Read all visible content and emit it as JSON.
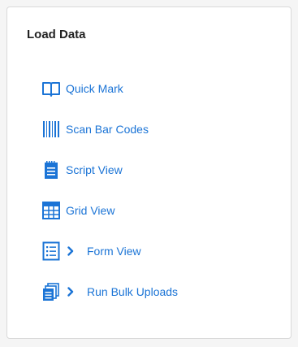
{
  "card": {
    "title": "Load Data"
  },
  "menu": {
    "items": [
      {
        "label": "Quick Mark",
        "icon": "book-icon",
        "expandable": false
      },
      {
        "label": "Scan Bar Codes",
        "icon": "barcode-icon",
        "expandable": false
      },
      {
        "label": "Script View",
        "icon": "script-icon",
        "expandable": false
      },
      {
        "label": "Grid View",
        "icon": "grid-icon",
        "expandable": false
      },
      {
        "label": "Form View",
        "icon": "form-icon",
        "expandable": true
      },
      {
        "label": "Run Bulk Uploads",
        "icon": "bulk-upload-icon",
        "expandable": true
      }
    ]
  },
  "colors": {
    "accent": "#1b74d6",
    "title": "#222222",
    "border": "#d9d9d9",
    "background": "#f5f5f5"
  }
}
